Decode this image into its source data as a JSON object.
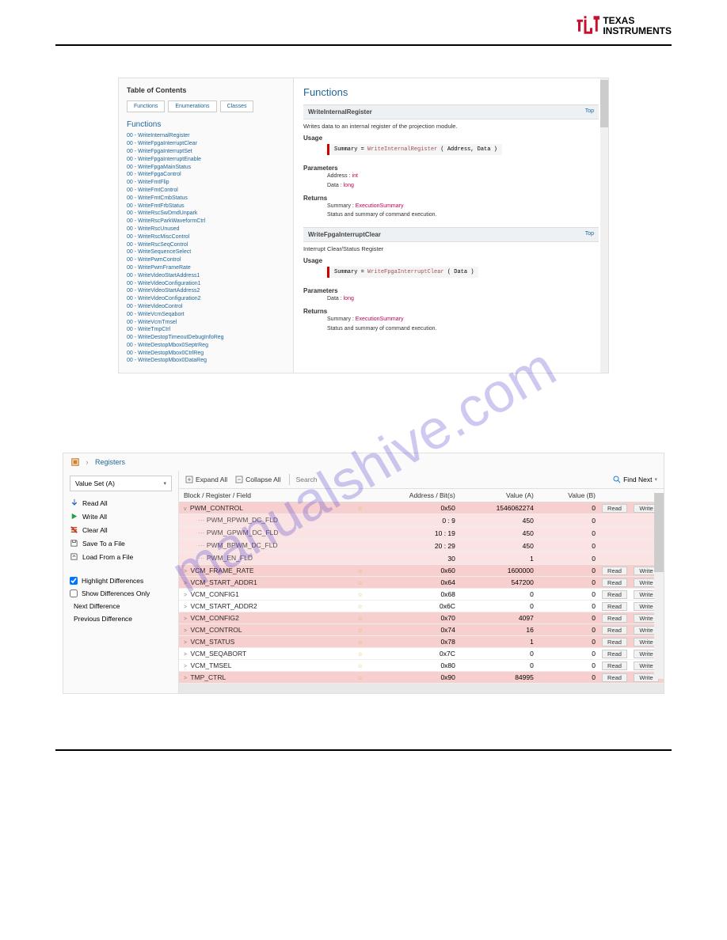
{
  "logo": {
    "line1": "TEXAS",
    "line2": "INSTRUMENTS"
  },
  "watermark": "manualshive.com",
  "panel1": {
    "toc_title": "Table of Contents",
    "tabs": [
      "Functions",
      "Enumerations",
      "Classes"
    ],
    "functions_header": "Functions",
    "functions": [
      "00 - WriteInternalRegister",
      "00 - WriteFpgaInterruptClear",
      "00 - WriteFpgaInterruptSet",
      "00 - WriteFpgaInterruptEnable",
      "00 - WriteFpgaMainStatus",
      "00 - WriteFpgaControl",
      "00 - WriteFmtFlip",
      "00 - WriteFmtControl",
      "00 - WriteFmtCmbStatus",
      "00 - WriteFmtFrbStatus",
      "00 - WriteRscSwDmdUnpark",
      "00 - WriteRscParkWaveformCtrl",
      "00 - WriteRscUnused",
      "00 - WriteRscMiscControl",
      "00 - WriteRscSeqControl",
      "00 - WriteSequenceSelect",
      "00 - WritePwmControl",
      "00 - WritePwmFrameRate",
      "00 - WriteVideoStartAddress1",
      "00 - WriteVideoConfiguration1",
      "00 - WriteVideoStartAddress2",
      "00 - WriteVideoConfiguration2",
      "00 - WriteVideoControl",
      "00 - WriteVcmSeqabort",
      "00 - WriteVcmTmsel",
      "00 - WriteTmpCtrl",
      "00 - WriteDestopTimeoutDebugInfoReg",
      "00 - WriteDestopMbox0SeptrReg",
      "00 - WriteDestopMbox0CtrlReg",
      "00 - WriteDestopMbox0DataReg"
    ],
    "content_title": "Functions",
    "sections": [
      {
        "name": "WriteInternalRegister",
        "top": "Top",
        "desc": "Writes data to an internal register of the projection module.",
        "usage_label": "Usage",
        "usage_code_pre": "Summary = ",
        "usage_fn": "WriteInternalRegister",
        "usage_args": " ( Address, Data )",
        "params_label": "Parameters",
        "params": [
          {
            "name": "Address :",
            "type": "int"
          },
          {
            "name": "Data :",
            "type": "long"
          }
        ],
        "returns_label": "Returns",
        "returns_line1_pre": "Summary : ",
        "returns_line1_type": "ExecutionSummary",
        "returns_line2": "Status and summary of command execution."
      },
      {
        "name": "WriteFpgaInterruptClear",
        "top": "Top",
        "desc": "Interrupt Clear/Status Register",
        "usage_label": "Usage",
        "usage_code_pre": "Summary = ",
        "usage_fn": "WriteFpgaInterruptClear",
        "usage_args": " ( Data )",
        "params_label": "Parameters",
        "params": [
          {
            "name": "Data :",
            "type": "long"
          }
        ],
        "returns_label": "Returns",
        "returns_line1_pre": "Summary : ",
        "returns_line1_type": "ExecutionSummary",
        "returns_line2": "Status and summary of command execution."
      }
    ]
  },
  "panel2": {
    "breadcrumb": "Registers",
    "value_set_label": "Value Set (A)",
    "side_actions": {
      "read_all": "Read All",
      "write_all": "Write All",
      "clear_all": "Clear All",
      "save_file": "Save To a File",
      "load_file": "Load From a File"
    },
    "side_checks": {
      "highlight": "Highlight Differences",
      "show_only": "Show Differences Only",
      "next_diff": "Next Difference",
      "prev_diff": "Previous Difference"
    },
    "toolbar": {
      "expand": "Expand All",
      "collapse": "Collapse All",
      "search_placeholder": "Search",
      "find_next": "Find Next"
    },
    "grid_headers": {
      "c0": "Block / Register / Field",
      "c1": "Address / Bit(s)",
      "c2": "Value (A)",
      "c3": "Value (B)"
    },
    "btn": {
      "read": "Read",
      "write": "Write"
    },
    "rows": [
      {
        "type": "reg",
        "diff": true,
        "exp": "v",
        "name": "PWM_CONTROL",
        "addr": "0x50",
        "va": "1546062274",
        "vb": "0",
        "rw": true
      },
      {
        "type": "fld",
        "diff": true,
        "name": "PWM_RPWM_DC_FLD",
        "addr": "0 : 9",
        "va": "450",
        "vb": "0"
      },
      {
        "type": "fld",
        "diff": true,
        "name": "PWM_GPWM_DC_FLD",
        "addr": "10 : 19",
        "va": "450",
        "vb": "0"
      },
      {
        "type": "fld",
        "diff": true,
        "name": "PWM_BPWM_DC_FLD",
        "addr": "20 : 29",
        "va": "450",
        "vb": "0"
      },
      {
        "type": "fld",
        "diff": true,
        "name": "PWM_EN_FLD",
        "addr": "30",
        "va": "1",
        "vb": "0"
      },
      {
        "type": "reg",
        "diff": true,
        "exp": ">",
        "name": "VCM_FRAME_RATE",
        "addr": "0x60",
        "va": "1600000",
        "vb": "0",
        "rw": true
      },
      {
        "type": "reg",
        "diff": true,
        "exp": ">",
        "name": "VCM_START_ADDR1",
        "addr": "0x64",
        "va": "547200",
        "vb": "0",
        "rw": true
      },
      {
        "type": "reg",
        "diff": false,
        "exp": ">",
        "name": "VCM_CONFIG1",
        "addr": "0x68",
        "va": "0",
        "vb": "0",
        "rw": true
      },
      {
        "type": "reg",
        "diff": false,
        "exp": ">",
        "name": "VCM_START_ADDR2",
        "addr": "0x6C",
        "va": "0",
        "vb": "0",
        "rw": true
      },
      {
        "type": "reg",
        "diff": true,
        "exp": ">",
        "name": "VCM_CONFIG2",
        "addr": "0x70",
        "va": "4097",
        "vb": "0",
        "rw": true
      },
      {
        "type": "reg",
        "diff": true,
        "exp": ">",
        "name": "VCM_CONTROL",
        "addr": "0x74",
        "va": "16",
        "vb": "0",
        "rw": true
      },
      {
        "type": "reg",
        "diff": true,
        "exp": ">",
        "name": "VCM_STATUS",
        "addr": "0x78",
        "va": "1",
        "vb": "0",
        "rw": true
      },
      {
        "type": "reg",
        "diff": false,
        "exp": ">",
        "name": "VCM_SEQABORT",
        "addr": "0x7C",
        "va": "0",
        "vb": "0",
        "rw": true
      },
      {
        "type": "reg",
        "diff": false,
        "exp": ">",
        "name": "VCM_TMSEL",
        "addr": "0x80",
        "va": "0",
        "vb": "0",
        "rw": true
      },
      {
        "type": "reg",
        "diff": true,
        "exp": ">",
        "name": "TMP_CTRL",
        "addr": "0x90",
        "va": "84995",
        "vb": "0",
        "rw": true
      }
    ]
  }
}
